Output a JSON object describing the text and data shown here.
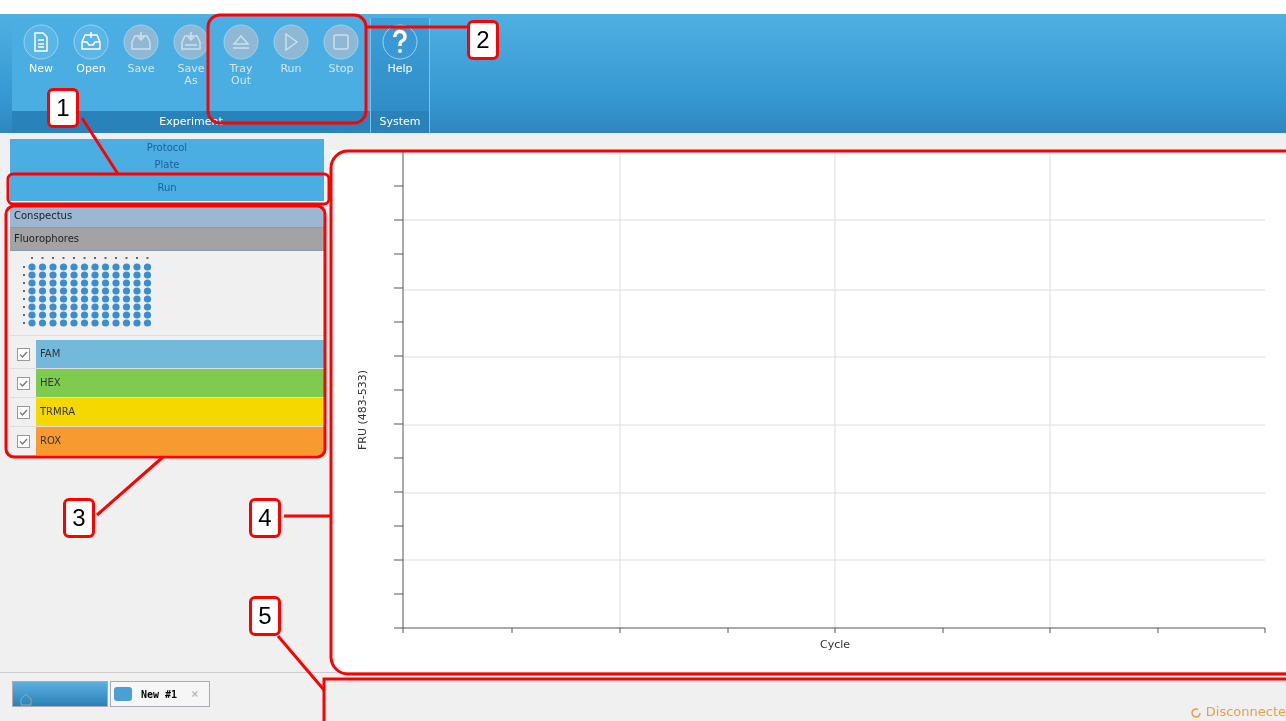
{
  "ribbon": {
    "groups": [
      {
        "label": "Experiment",
        "buttons": [
          {
            "label": "New",
            "kind": "new",
            "disabled": false
          },
          {
            "label": "Open",
            "kind": "open",
            "disabled": false
          },
          {
            "label": "Save",
            "kind": "save",
            "disabled": true
          },
          {
            "label": "Save As",
            "kind": "save-as",
            "disabled": true
          },
          {
            "label": "Tray Out",
            "kind": "eject",
            "disabled": true
          },
          {
            "label": "Run",
            "kind": "run",
            "disabled": true
          },
          {
            "label": "Stop",
            "kind": "stop",
            "disabled": true
          }
        ]
      },
      {
        "label": "System",
        "buttons": [
          {
            "label": "Help",
            "kind": "help",
            "disabled": false
          }
        ]
      }
    ]
  },
  "nav": [
    "Protocol",
    "Plate",
    "Run"
  ],
  "sections": [
    "Conspectus",
    "Fluorophores"
  ],
  "fluorophores": [
    {
      "name": "FAM",
      "checked": true,
      "color": "#73b9dc"
    },
    {
      "name": "HEX",
      "checked": true,
      "color": "#7dcc50"
    },
    {
      "name": "TRMRA",
      "checked": true,
      "color": "#f5d800"
    },
    {
      "name": "ROX",
      "checked": true,
      "color": "#f79a30"
    }
  ],
  "chart": {
    "ylabel": "FRU (483-533)",
    "xlabel": "Cycle"
  },
  "doc_tabs": [
    {
      "kind": "home",
      "selected": false
    },
    {
      "label": "New #1",
      "kind": "doc",
      "selected": true,
      "close": "×"
    }
  ],
  "status": "Disconnecte",
  "callouts": [
    "1",
    "2",
    "3",
    "4",
    "5"
  ]
}
